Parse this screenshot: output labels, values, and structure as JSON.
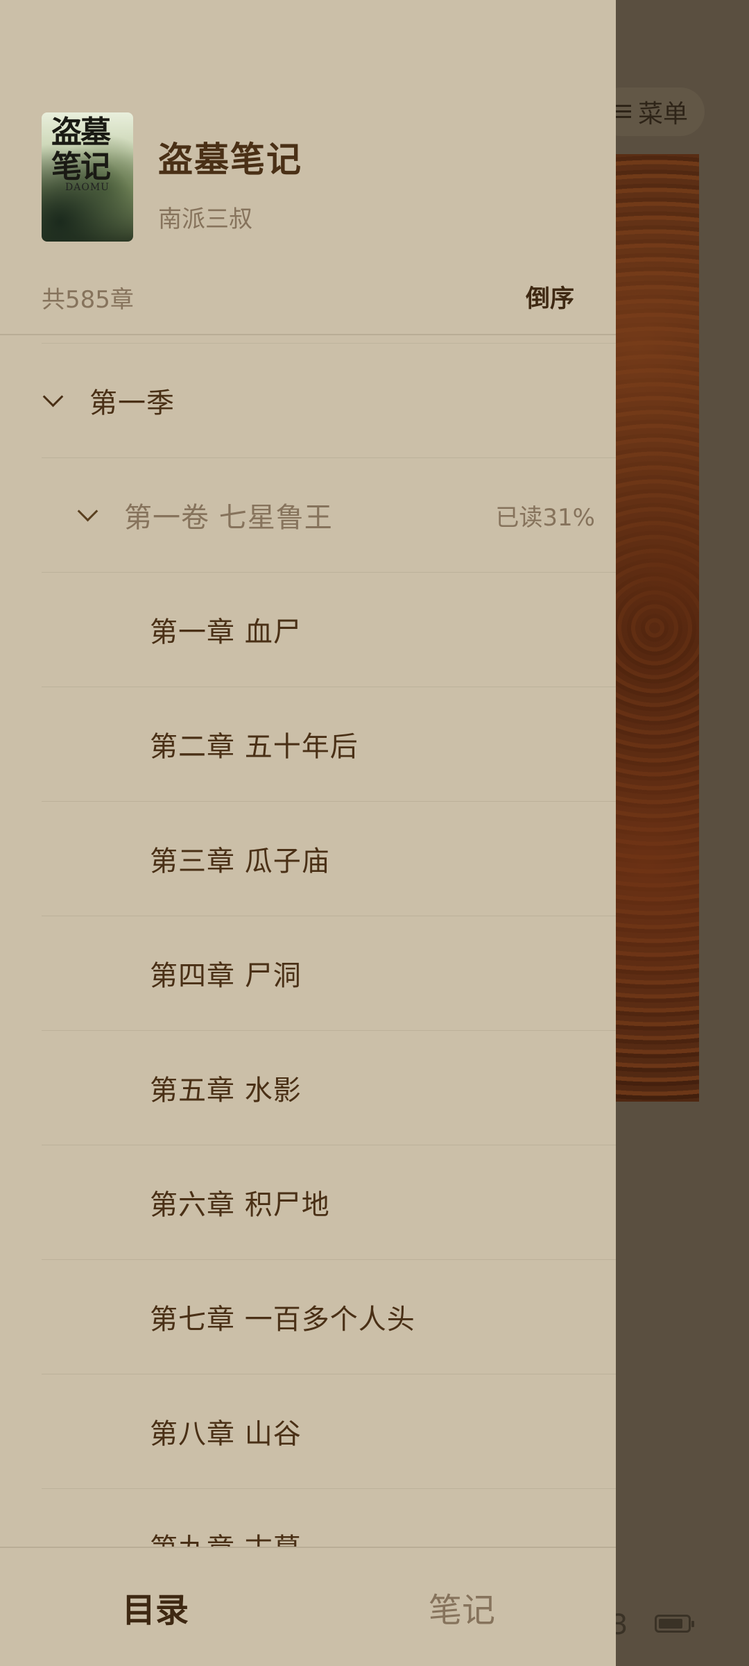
{
  "background": {
    "menu_label": "菜单",
    "page_number": "3"
  },
  "book": {
    "cover_title": "盗墓笔记",
    "cover_subtitle": "DAOMU",
    "title": "盗墓笔记",
    "author": "南派三叔"
  },
  "toc_header": {
    "chapter_count": "共585章",
    "sort_label": "倒序"
  },
  "toc": {
    "season": "第一季",
    "volume": "第一卷  七星鲁王",
    "volume_progress": "已读31%",
    "chapters": [
      "第一章  血尸",
      "第二章  五十年后",
      "第三章  瓜子庙",
      "第四章  尸洞",
      "第五章  水影",
      "第六章  积尸地",
      "第七章  一百多个人头",
      "第八章  山谷",
      "第九章  古墓"
    ]
  },
  "tabs": {
    "contents": "目录",
    "notes": "笔记"
  },
  "colors": {
    "drawer_bg": "#cbbfa8",
    "primary_text": "#4a3016",
    "secondary_text": "#86735c",
    "overlay_bg": "#5a4f40"
  }
}
